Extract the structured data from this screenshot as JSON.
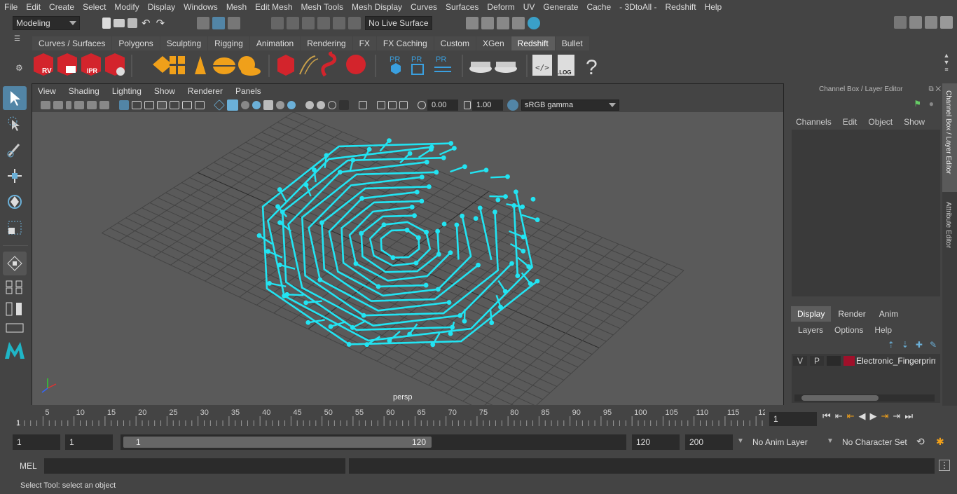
{
  "menu": [
    "File",
    "Edit",
    "Create",
    "Select",
    "Modify",
    "Display",
    "Windows",
    "Mesh",
    "Edit Mesh",
    "Mesh Tools",
    "Mesh Display",
    "Curves",
    "Surfaces",
    "Deform",
    "UV",
    "Generate",
    "Cache",
    "- 3DtoAll -",
    "Redshift",
    "Help"
  ],
  "status": {
    "mode": "Modeling",
    "live_surface": "No Live Surface"
  },
  "shelf_tabs": [
    "Curves / Surfaces",
    "Polygons",
    "Sculpting",
    "Rigging",
    "Animation",
    "Rendering",
    "FX",
    "FX Caching",
    "Custom",
    "XGen",
    "Redshift",
    "Bullet"
  ],
  "shelf_active": "Redshift",
  "shelf_labels": {
    "rv": "RV",
    "ipr": "IPR",
    "pr1": "PR",
    "pr2": "PR",
    "pr3": "PR",
    "log": ".LOG",
    "help": "?"
  },
  "viewport": {
    "menu": [
      "View",
      "Shading",
      "Lighting",
      "Show",
      "Renderer",
      "Panels"
    ],
    "exposure": "0.00",
    "gamma": "1.00",
    "color_space": "sRGB gamma",
    "camera": "persp"
  },
  "channel_box": {
    "title": "Channel Box / Layer Editor",
    "menu": [
      "Channels",
      "Edit",
      "Object",
      "Show"
    ],
    "layer_tabs": [
      "Display",
      "Render",
      "Anim"
    ],
    "layer_active": "Display",
    "layer_menu": [
      "Layers",
      "Options",
      "Help"
    ],
    "layer": {
      "v": "V",
      "p": "P",
      "name": "Electronic_Fingerprint",
      "color": "#a0102a"
    }
  },
  "side_tabs": [
    "Channel Box / Layer Editor",
    "Attribute Editor"
  ],
  "timeline": {
    "ticks": [
      "5",
      "10",
      "15",
      "20",
      "25",
      "30",
      "35",
      "40",
      "45",
      "50",
      "55",
      "60",
      "65",
      "70",
      "75",
      "80",
      "85",
      "90",
      "95",
      "100",
      "105",
      "110",
      "115",
      "12"
    ],
    "start_mark": "1",
    "current": "1"
  },
  "range": {
    "start": "1",
    "playback_start": "1",
    "slider_start": "1",
    "slider_end": "120",
    "playback_end": "120",
    "end": "200",
    "anim_layer": "No Anim Layer",
    "char_set": "No Character Set"
  },
  "command": {
    "label": "MEL"
  },
  "help_line": "Select Tool: select an object",
  "colors": {
    "trace": "#22e4f2",
    "active_tab": "#5d5d5d",
    "select": "#5285a6"
  }
}
